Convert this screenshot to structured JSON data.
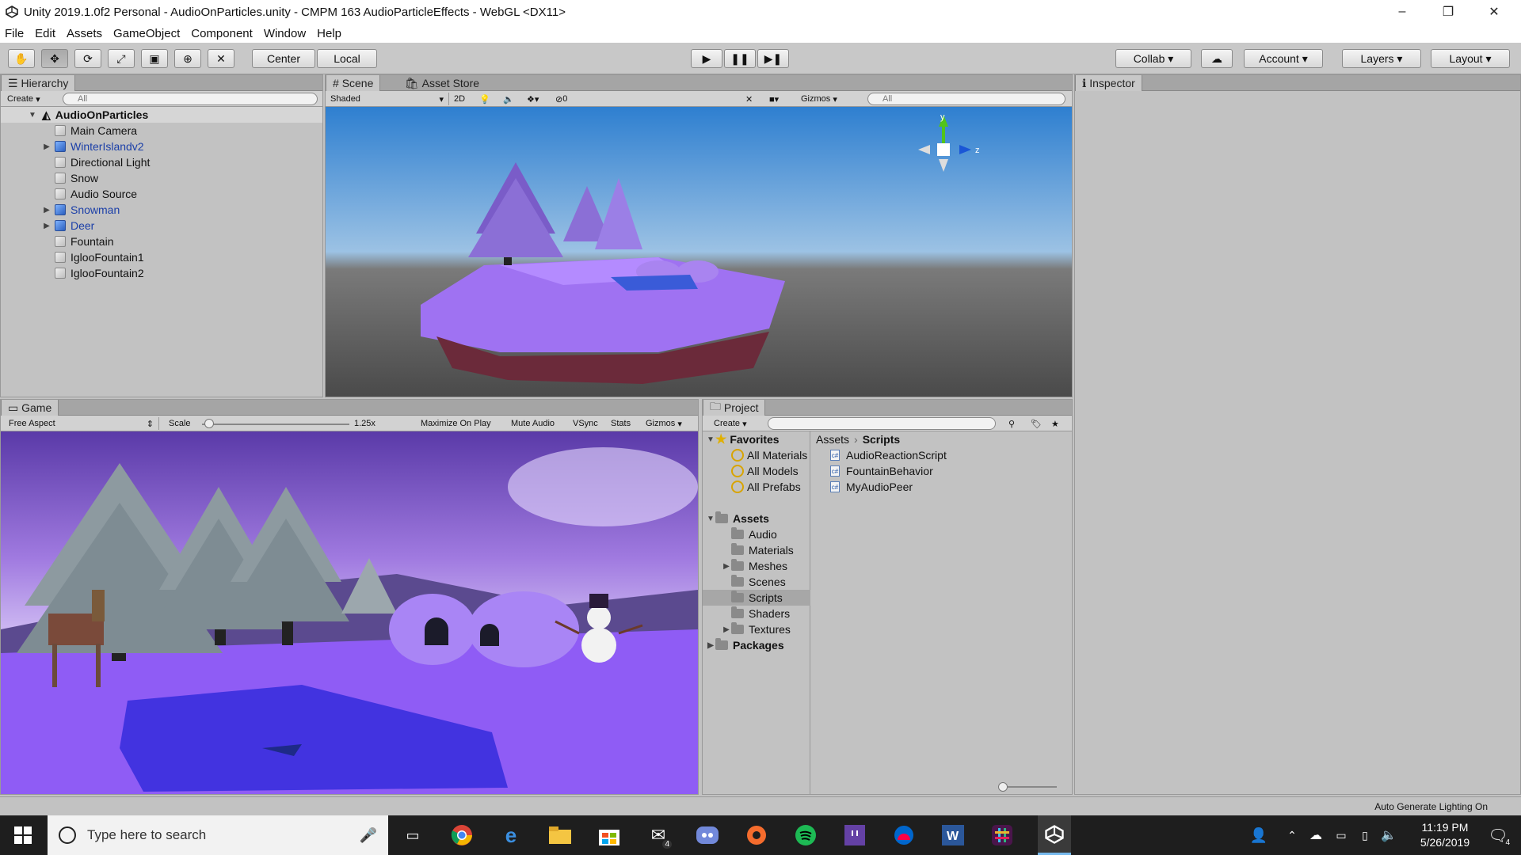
{
  "window": {
    "title": "Unity 2019.1.0f2 Personal - AudioOnParticles.unity - CMPM 163 AudioParticleEffects - WebGL <DX11>",
    "minimize": "–",
    "maximize": "❐",
    "close": "✕"
  },
  "menu": [
    "File",
    "Edit",
    "Assets",
    "GameObject",
    "Component",
    "Window",
    "Help"
  ],
  "toolbar": {
    "pivot": "Center",
    "space": "Local",
    "collab": "Collab",
    "account": "Account",
    "layers": "Layers",
    "layout": "Layout"
  },
  "hierarchy": {
    "tab": "Hierarchy",
    "create": "Create",
    "search_placeholder": "All",
    "scene": "AudioOnParticles",
    "items": [
      {
        "label": "Main Camera",
        "prefab": false,
        "expandable": false
      },
      {
        "label": "WinterIslandv2",
        "prefab": true,
        "expandable": true
      },
      {
        "label": "Directional Light",
        "prefab": false,
        "expandable": false
      },
      {
        "label": "Snow",
        "prefab": false,
        "expandable": false
      },
      {
        "label": "Audio Source",
        "prefab": false,
        "expandable": false
      },
      {
        "label": "Snowman",
        "prefab": true,
        "expandable": true
      },
      {
        "label": "Deer",
        "prefab": true,
        "expandable": true
      },
      {
        "label": "Fountain",
        "prefab": false,
        "expandable": false
      },
      {
        "label": "IglooFountain1",
        "prefab": false,
        "expandable": false
      },
      {
        "label": "IglooFountain2",
        "prefab": false,
        "expandable": false
      }
    ]
  },
  "scene": {
    "tab": "Scene",
    "tab2": "Asset Store",
    "shading": "Shaded",
    "mode2d": "2D",
    "hidden_count": "0",
    "gizmos": "Gizmos",
    "search_placeholder": "All",
    "axis_y": "y",
    "axis_z": "z"
  },
  "game": {
    "tab": "Game",
    "aspect": "Free Aspect",
    "scale_label": "Scale",
    "scale_value": "1.25x",
    "scale_fraction": 0.02,
    "maximize": "Maximize On Play",
    "mute": "Mute Audio",
    "vsync": "VSync",
    "stats": "Stats",
    "gizmos": "Gizmos"
  },
  "project": {
    "tab": "Project",
    "create": "Create",
    "favorites": "Favorites",
    "fav_items": [
      "All Materials",
      "All Models",
      "All Prefabs"
    ],
    "assets": "Assets",
    "folders": [
      {
        "label": "Audio",
        "expandable": false
      },
      {
        "label": "Materials",
        "expandable": false
      },
      {
        "label": "Meshes",
        "expandable": true
      },
      {
        "label": "Scenes",
        "expandable": false
      },
      {
        "label": "Scripts",
        "expandable": false,
        "selected": true
      },
      {
        "label": "Shaders",
        "expandable": false
      },
      {
        "label": "Textures",
        "expandable": true
      }
    ],
    "packages": "Packages",
    "breadcrumb": [
      "Assets",
      "Scripts"
    ],
    "files": [
      "AudioReactionScript",
      "FountainBehavior",
      "MyAudioPeer"
    ]
  },
  "inspector": {
    "tab": "Inspector"
  },
  "status": {
    "text": "Auto Generate Lighting On"
  },
  "taskbar": {
    "search_placeholder": "Type here to search",
    "time": "11:19 PM",
    "date": "5/26/2019",
    "mail_badge": "4",
    "notif_badge": "4"
  },
  "colors": {
    "prefab_text": "#1b3fa8",
    "accent": "#0078d7"
  }
}
